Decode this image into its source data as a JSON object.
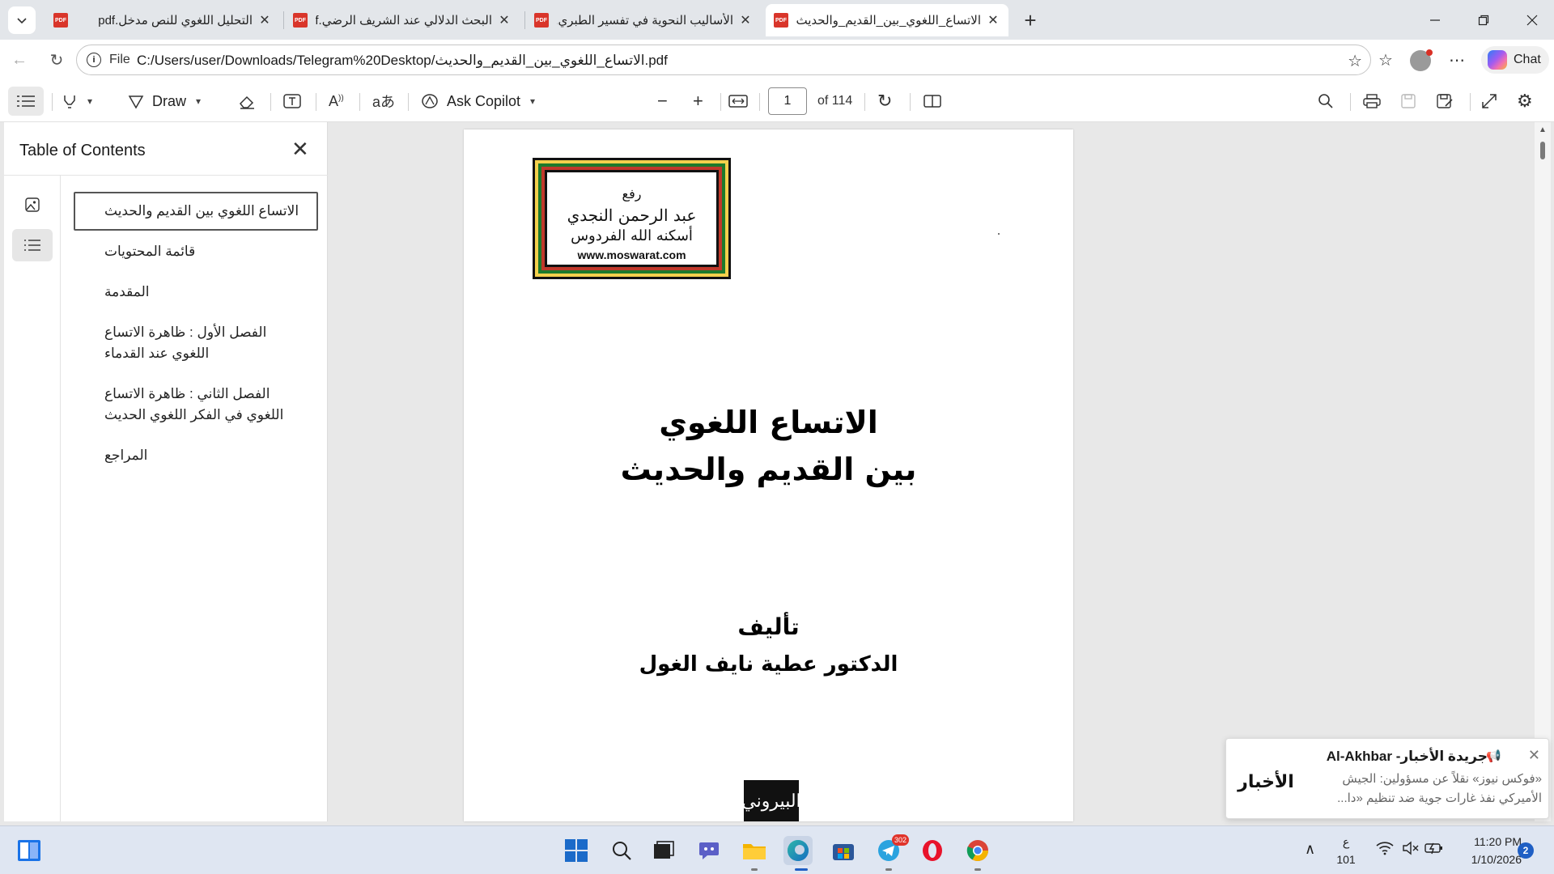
{
  "browser": {
    "tabs": [
      {
        "title": "التحليل اللغوي للنص مدخل.pdf",
        "active": false
      },
      {
        "title": "البحث الدلالي عند الشريف الرضي.pdf",
        "active": false
      },
      {
        "title": "الأساليب النحوية في تفسير الطبري.pdf",
        "active": false
      },
      {
        "title": "الاتساع_اللغوي_بين_القديم_والحديث.pdf",
        "active": true
      }
    ],
    "address": {
      "scheme_label": "File",
      "url": "C:/Users/user/Downloads/Telegram%20Desktop/الاتساع_اللغوي_بين_القديم_والحديث.pdf"
    },
    "chat_label": "Chat"
  },
  "pdf_toolbar": {
    "draw_label": "Draw",
    "ask_copilot_label": "Ask Copilot",
    "page_current": "1",
    "page_total": "of 114"
  },
  "toc": {
    "title": "Table of Contents",
    "items": [
      "الاتساع اللغوي بين القديم والحديث",
      "قائمة المحتويات",
      "المقدمة",
      "الفصل الأول : ظاهرة الاتساع اللغوي عند القدماء",
      "الفصل الثاني : ظاهرة الاتساع اللغوي في الفكر اللغوي الحديث",
      "المراجع"
    ]
  },
  "document": {
    "seal_lines": [
      "رفع",
      "عبد الرحمن النجدي",
      "أسكنه الله الفردوس"
    ],
    "seal_url": "www.moswarat.com",
    "title_line1": "الاتساع اللغوي",
    "title_line2": "بين القديم والحديث",
    "author_label": "تأليف",
    "author_name": "الدكتور عطية نايف الغول",
    "publisher_logo": "البيروني"
  },
  "notification": {
    "source": "جريدة الأخبار- Al-Akhbar",
    "logo_text": "الأخبار",
    "body": "«فوكس نيوز» نقلاً عن مسؤولين: الجيش الأميركي نفذ غارات جوية ضد تنظيم «دا..."
  },
  "taskbar": {
    "ime_line1": "ع",
    "ime_line2": "101",
    "time": "11:20 PM",
    "date": "1/10/2026",
    "notification_count": "2",
    "telegram_badge": "302"
  }
}
